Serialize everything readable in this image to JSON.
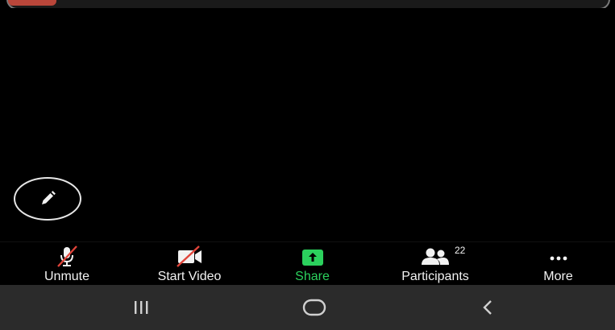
{
  "top_accent_color": "#b9463a",
  "annotate": {
    "icon": "pencil-icon"
  },
  "toolbar": {
    "unmute": {
      "label": "Unmute",
      "icon": "microphone-muted-icon"
    },
    "start_video": {
      "label": "Start Video",
      "icon": "video-camera-off-icon"
    },
    "share": {
      "label": "Share",
      "icon": "share-up-arrow-icon",
      "color": "#2bd15d"
    },
    "participants": {
      "label": "Participants",
      "icon": "participants-icon",
      "count": "22"
    },
    "more": {
      "label": "More",
      "icon": "more-dots-icon"
    }
  },
  "navbar": {
    "recents": {
      "icon": "recent-apps-icon"
    },
    "home": {
      "icon": "home-icon"
    },
    "back": {
      "icon": "back-icon"
    }
  }
}
